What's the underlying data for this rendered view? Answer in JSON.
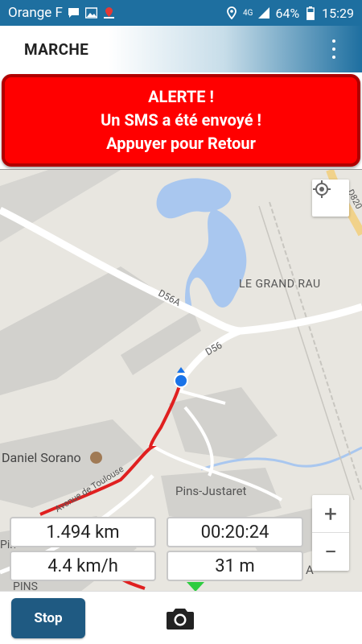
{
  "status_bar": {
    "carrier": "Orange F",
    "network": "4G",
    "battery": "64%",
    "time": "15:29",
    "icons": [
      "chat-icon",
      "image-icon",
      "location-pin-icon",
      "location-icon",
      "signal-icon",
      "battery-icon"
    ]
  },
  "app_bar": {
    "title": "MARCHE",
    "menu_icon": "more-vert-icon"
  },
  "alert": {
    "line1": "ALERTE !",
    "line2": "Un SMS a été envoyé !",
    "line3": "Appuyer pour Retour"
  },
  "map": {
    "labels": {
      "d56a": "D56A",
      "d56": "D56",
      "d820": "D820",
      "le_grand_rau": "LE GRAND RAU",
      "daniel_sorano": "Daniel Sorano",
      "avenue_de_toulouse": "Avenue de Toulouse",
      "pins_justaret": "Pins-Justaret",
      "pins": "PINS",
      "pin_partial": "Pin",
      "a_partial": "A"
    },
    "colors": {
      "route": "#e02020",
      "water": "#a9c7ef",
      "road": "#ffffff",
      "block": "#d2d1cd",
      "position": "#1a73e8"
    },
    "zoom_in": "+",
    "zoom_out": "−"
  },
  "stats": {
    "distance": "1.494 km",
    "duration": "00:20:24",
    "speed": "4.4 km/h",
    "altitude": "31 m"
  },
  "bottom": {
    "stop_label": "Stop",
    "camera_icon": "camera-icon"
  }
}
